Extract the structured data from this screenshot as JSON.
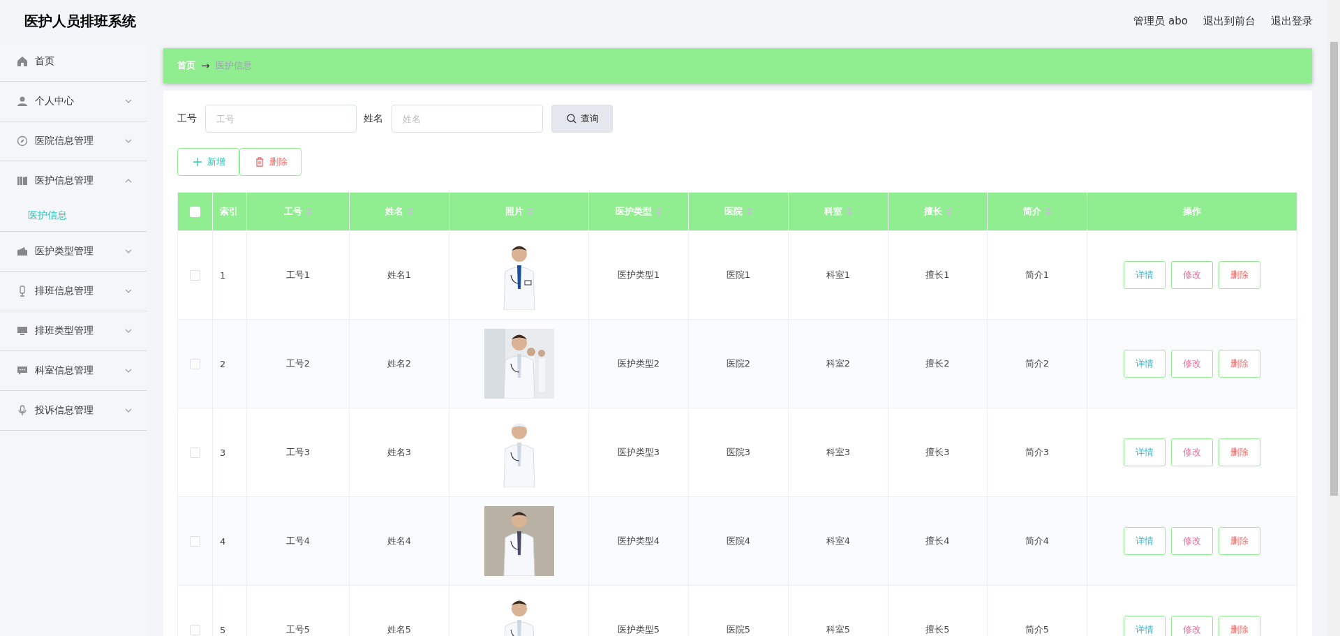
{
  "header": {
    "title": "医护人员排班系统",
    "user": "管理员 abo",
    "links": [
      "退出到前台",
      "退出登录"
    ]
  },
  "sidebar": {
    "items": [
      {
        "label": "首页",
        "expandable": false,
        "expanded": false
      },
      {
        "label": "个人中心",
        "expandable": true,
        "expanded": false
      },
      {
        "label": "医院信息管理",
        "expandable": true,
        "expanded": false
      },
      {
        "label": "医护信息管理",
        "expandable": true,
        "expanded": true,
        "children": [
          {
            "label": "医护信息",
            "selected": true
          }
        ]
      },
      {
        "label": "医护类型管理",
        "expandable": true,
        "expanded": false
      },
      {
        "label": "排班信息管理",
        "expandable": true,
        "expanded": false
      },
      {
        "label": "排班类型管理",
        "expandable": true,
        "expanded": false
      },
      {
        "label": "科室信息管理",
        "expandable": true,
        "expanded": false
      },
      {
        "label": "投诉信息管理",
        "expandable": true,
        "expanded": false
      }
    ]
  },
  "breadcrumb": {
    "home": "首页",
    "separator": "→",
    "current": "医护信息"
  },
  "search": {
    "fields": [
      {
        "label": "工号",
        "placeholder": "工号"
      },
      {
        "label": "姓名",
        "placeholder": "姓名"
      }
    ],
    "button": "查询"
  },
  "actions": [
    {
      "kind": "add",
      "label": "新增"
    },
    {
      "kind": "delete",
      "label": "删除"
    }
  ],
  "table": {
    "select_all_checked": false,
    "columns": [
      {
        "kind": "text",
        "label": "索引",
        "sortable": false
      },
      {
        "kind": "text",
        "label": "工号",
        "sortable": true
      },
      {
        "kind": "text",
        "label": "姓名",
        "sortable": true
      },
      {
        "label": "照片",
        "sortable": true
      },
      {
        "kind": "text",
        "label": "医护类型",
        "sortable": true
      },
      {
        "kind": "text",
        "label": "医院",
        "sortable": true
      },
      {
        "kind": "text",
        "label": "科室",
        "sortable": true
      },
      {
        "kind": "text",
        "label": "擅长",
        "sortable": true
      },
      {
        "kind": "text",
        "label": "简介",
        "sortable": true
      },
      {
        "kind": "actions",
        "label": "操作",
        "sortable": false
      }
    ],
    "rows": [
      {
        "checked": false,
        "cells": [
          "1",
          "工号1",
          "姓名1",
          {
            "kind": "picture"
          },
          "医护类型1",
          "医院1",
          "科室1",
          "擅长1",
          "简介1",
          [
            "详情",
            "修改",
            "删除"
          ]
        ]
      },
      {
        "checked": false,
        "cells": [
          "2",
          "工号2",
          "姓名2",
          {
            "kind": "picture"
          },
          "医护类型2",
          "医院2",
          "科室2",
          "擅长2",
          "简介2",
          [
            "详情",
            "修改",
            "删除"
          ]
        ]
      },
      {
        "checked": false,
        "cells": [
          "3",
          "工号3",
          "姓名3",
          {
            "kind": "picture"
          },
          "医护类型3",
          "医院3",
          "科室3",
          "擅长3",
          "简介3",
          [
            "详情",
            "修改",
            "删除"
          ]
        ]
      },
      {
        "checked": false,
        "cells": [
          "4",
          "工号4",
          "姓名4",
          {
            "kind": "picture"
          },
          "医护类型4",
          "医院4",
          "科室4",
          "擅长4",
          "简介4",
          [
            "详情",
            "修改",
            "删除"
          ]
        ]
      },
      {
        "checked": false,
        "cells": [
          "5",
          "工号5",
          "姓名5",
          {
            "kind": "picture"
          },
          "医护类型5",
          "医院5",
          "科室5",
          "擅长5",
          "简介5",
          [
            "详情",
            "修改",
            "删除"
          ]
        ]
      }
    ]
  }
}
